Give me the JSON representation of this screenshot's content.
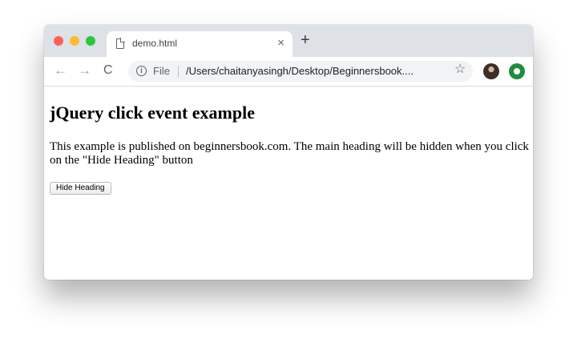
{
  "browser": {
    "tab_title": "demo.html",
    "tab_close": "×",
    "new_tab": "+",
    "address_scheme_label": "File",
    "address_url": "/Users/chaitanyasingh/Desktop/Beginnersbook....",
    "nav": {
      "back": "←",
      "forward": "→",
      "reload": "C"
    },
    "star": "☆"
  },
  "page": {
    "heading": "jQuery click event example",
    "paragraph": "This example is published on beginnersbook.com. The main heading will be hidden when you click on the \"Hide Heading\" button",
    "button_label": "Hide Heading"
  },
  "colors": {
    "traffic_red": "#ff5f57",
    "traffic_yellow": "#febc2e",
    "traffic_green": "#28c840",
    "tab_strip": "#dee1e6",
    "omnibox": "#f1f3f4"
  },
  "icons": [
    "page-icon",
    "close-icon",
    "plus-icon",
    "back-arrow-icon",
    "forward-arrow-icon",
    "reload-icon",
    "info-icon",
    "star-icon",
    "profile-avatar",
    "extension-icon"
  ]
}
